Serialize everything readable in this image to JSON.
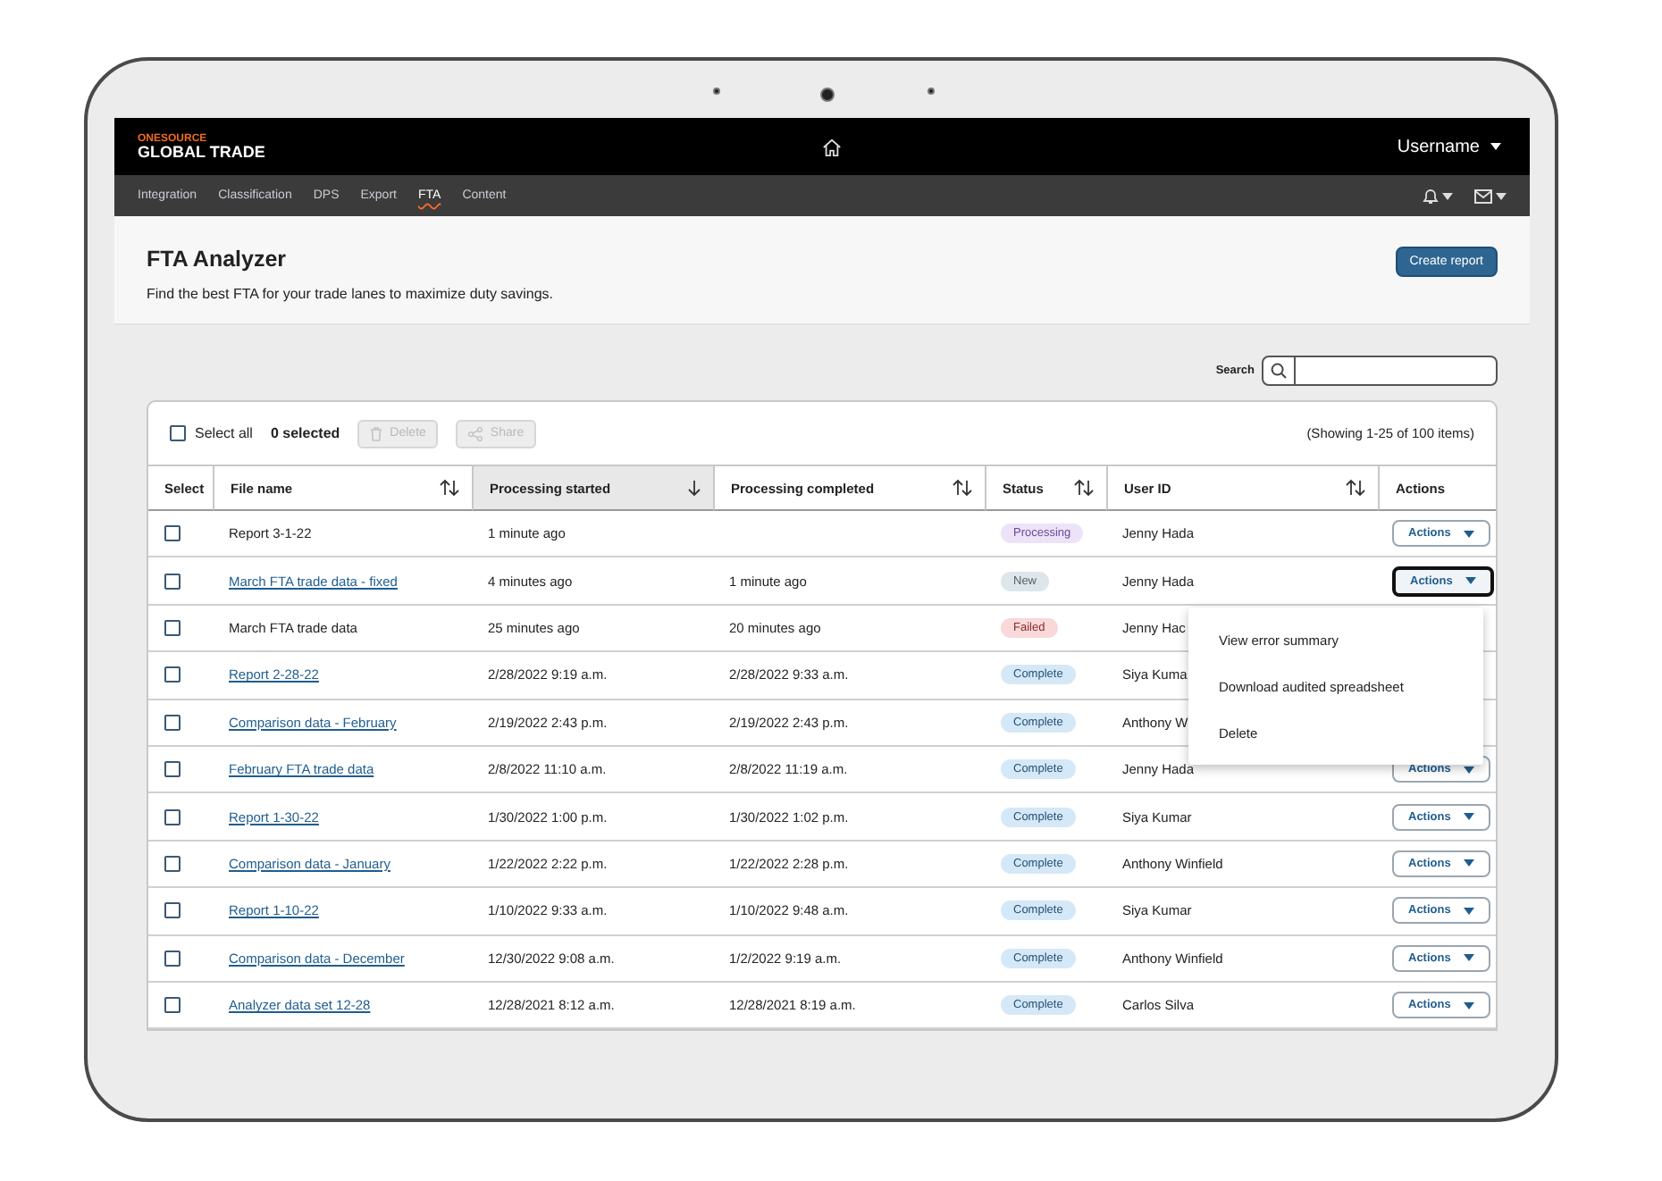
{
  "header": {
    "logo_top": "ONESOURCE",
    "logo_bottom": "GLOBAL TRADE",
    "user": "Username"
  },
  "nav": [
    {
      "label": "Integration",
      "selected": false
    },
    {
      "label": "Classification",
      "selected": false
    },
    {
      "label": "DPS",
      "selected": false
    },
    {
      "label": "Export",
      "selected": false
    },
    {
      "label": "FTA",
      "selected": true
    },
    {
      "label": "Content",
      "selected": false
    }
  ],
  "page": {
    "title": "FTA Analyzer",
    "subtitle": "Find the best FTA for your trade lanes to maximize duty savings.",
    "create_button": "Create report"
  },
  "search": {
    "label": "Search"
  },
  "toolbar": {
    "select_all": "Select all",
    "select_all_checked": false,
    "selected_count": "0 selected",
    "delete": "Delete",
    "delete_disabled": true,
    "share": "Share",
    "share_disabled": true,
    "showing": "(Showing 1-25 of 100 items)"
  },
  "columns": [
    {
      "label": "Select",
      "kind": "plain"
    },
    {
      "label": "File name",
      "kind": "sortable"
    },
    {
      "label": "Processing started",
      "kind": "sorted"
    },
    {
      "label": "Processing completed",
      "kind": "sortable"
    },
    {
      "label": "Status",
      "kind": "sortable"
    },
    {
      "label": "User ID",
      "kind": "sortable"
    },
    {
      "label": "Actions",
      "kind": "plain"
    }
  ],
  "rows": [
    {
      "checked": false,
      "file": "Report 3-1-22",
      "link": false,
      "started": "1 minute ago",
      "status": {
        "label": "Processing",
        "kind": "processing"
      },
      "user": "Jenny Hada",
      "actions": "Actions",
      "expanded": false
    },
    {
      "checked": false,
      "file": "March FTA trade data - fixed",
      "link": true,
      "started": "4 minutes ago",
      "completed": "1 minute ago",
      "status": {
        "label": "New",
        "kind": "new"
      },
      "user": "Jenny Hada",
      "actions": "Actions",
      "expanded": true
    },
    {
      "checked": false,
      "file": "March FTA trade data",
      "link": false,
      "started": "25 minutes ago",
      "completed": "20 minutes ago",
      "status": {
        "label": "Failed",
        "kind": "failed"
      },
      "user": "Jenny Hac"
    },
    {
      "checked": false,
      "file": "Report 2-28-22",
      "link": true,
      "started": "2/28/2022 9:19 a.m.",
      "completed": "2/28/2022 9:33 a.m.",
      "status": {
        "label": "Complete",
        "kind": "complete"
      },
      "user": "Siya Kuma"
    },
    {
      "checked": false,
      "file": "Comparison data - February",
      "link": true,
      "started": "2/19/2022 2:43 p.m.",
      "completed": "2/19/2022 2:43 p.m.",
      "status": {
        "label": "Complete",
        "kind": "complete"
      },
      "user": "Anthony W"
    },
    {
      "checked": false,
      "file": "February FTA trade data",
      "link": true,
      "started": "2/8/2022 11:10 a.m.",
      "completed": "2/8/2022 11:19 a.m.",
      "status": {
        "label": "Complete",
        "kind": "complete"
      },
      "user": "Jenny Hada",
      "actions": "Actions",
      "expanded": false
    },
    {
      "checked": false,
      "file": "Report 1-30-22",
      "link": true,
      "started": "1/30/2022 1:00 p.m.",
      "completed": "1/30/2022 1:02 p.m.",
      "status": {
        "label": "Complete",
        "kind": "complete"
      },
      "user": "Siya Kumar",
      "actions": "Actions",
      "expanded": false
    },
    {
      "checked": false,
      "file": "Comparison data - January",
      "link": true,
      "started": "1/22/2022 2:22 p.m.",
      "completed": "1/22/2022 2:28 p.m.",
      "status": {
        "label": "Complete",
        "kind": "complete"
      },
      "user": "Anthony Winfield",
      "actions": "Actions",
      "expanded": false
    },
    {
      "checked": false,
      "file": "Report 1-10-22",
      "link": true,
      "started": "1/10/2022 9:33 a.m.",
      "completed": "1/10/2022 9:48 a.m.",
      "status": {
        "label": "Complete",
        "kind": "complete"
      },
      "user": "Siya Kumar",
      "actions": "Actions",
      "expanded": false
    },
    {
      "checked": false,
      "file": "Comparison data - December",
      "link": true,
      "started": "12/30/2022 9:08 a.m.",
      "completed": "1/2/2022 9:19 a.m.",
      "status": {
        "label": "Complete",
        "kind": "complete"
      },
      "user": "Anthony Winfield",
      "actions": "Actions",
      "expanded": false
    },
    {
      "checked": false,
      "file": "Analyzer data set 12-28",
      "link": true,
      "started": "12/28/2021 8:12 a.m.",
      "completed": "12/28/2021 8:19 a.m.",
      "status": {
        "label": "Complete",
        "kind": "complete"
      },
      "user": "Carlos Silva",
      "actions": "Actions",
      "expanded": false
    }
  ],
  "menu": {
    "items": [
      "View error summary",
      "Download audited spreadsheet",
      "Delete"
    ]
  }
}
